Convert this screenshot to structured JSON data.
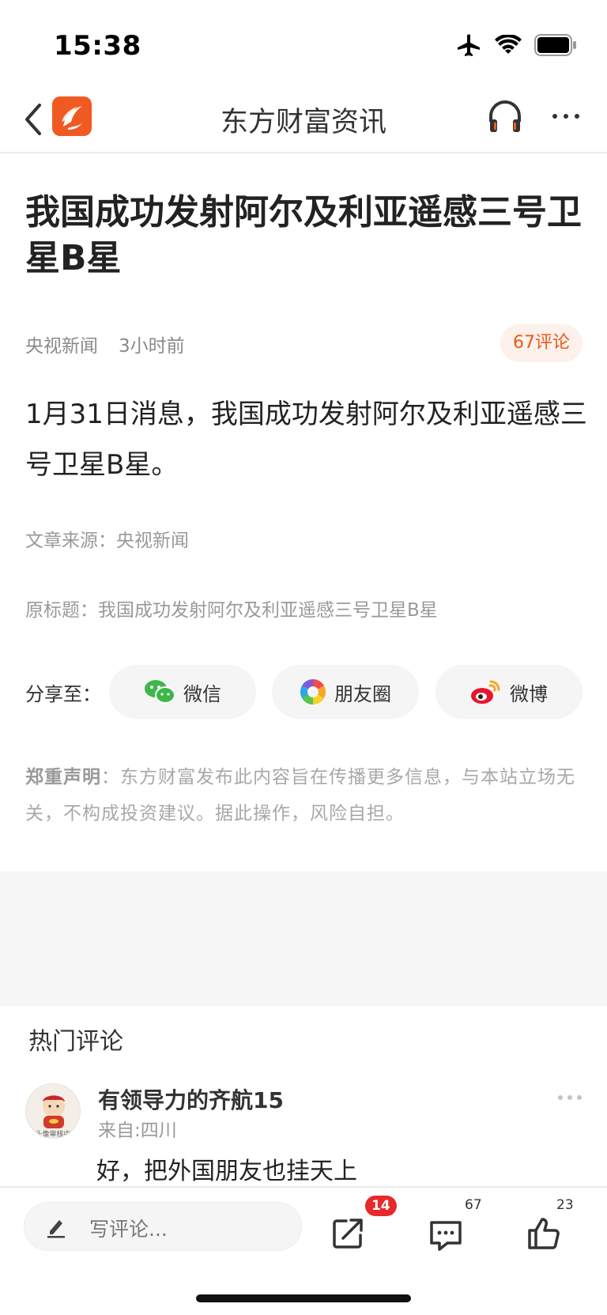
{
  "status_bar": {
    "time": "15:38",
    "icons": [
      "airplane-icon",
      "wifi-icon",
      "battery-icon"
    ]
  },
  "nav": {
    "title": "东方财富资讯",
    "icons": [
      "back-icon",
      "app-logo-icon",
      "headphones-icon",
      "more-icon"
    ]
  },
  "article": {
    "title": "我国成功发射阿尔及利亚遥感三号卫星B星",
    "source": "央视新闻",
    "time_ago": "3小时前",
    "comment_count_label": "67评论",
    "lead": "1月31日消息，我国成功发射阿尔及利亚遥感三号卫星B星。",
    "source_line": "文章来源：央视新闻",
    "original_title_line": "原标题：我国成功发射阿尔及利亚遥感三号卫星B星"
  },
  "share": {
    "label": "分享至：",
    "buttons": [
      {
        "label": "微信",
        "icon": "wechat-icon"
      },
      {
        "label": "朋友圈",
        "icon": "moments-icon"
      },
      {
        "label": "微博",
        "icon": "weibo-icon"
      }
    ]
  },
  "disclaimer": {
    "title": "郑重声明",
    "text": "：东方财富发布此内容旨在传播更多信息，与本站立场无关，不构成投资建议。据此操作，风险自担。"
  },
  "comments": {
    "section_title": "热门评论",
    "items": [
      {
        "user": "有领导力的齐航15",
        "from": "来自:四川",
        "text": "好，把外国朋友也挂天上",
        "avatar_caption": "头像审核中"
      }
    ]
  },
  "bottom_bar": {
    "write_placeholder": "写评论...",
    "share_badge": "14",
    "comment_count": "67",
    "like_count": "23"
  },
  "colors": {
    "accent": "#f05a22",
    "badge": "#e8282a",
    "pill_bg": "#fdf1ec",
    "pill_text": "#ea5a1b"
  }
}
